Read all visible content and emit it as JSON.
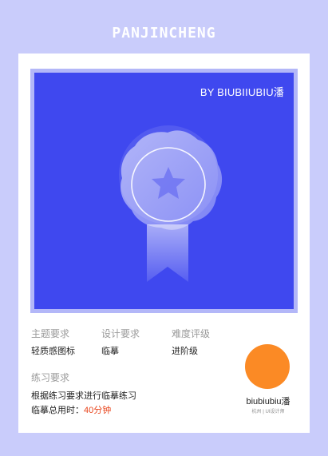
{
  "header": {
    "brand": "PANJINCHENG"
  },
  "hero": {
    "byline": "BY BIUBIIUBIU潘",
    "background_color": "#3f48ef",
    "icon": "medal-star-icon"
  },
  "info": {
    "theme": {
      "label": "主题要求",
      "value": "轻质感图标"
    },
    "design": {
      "label": "设计要求",
      "value": "临摹"
    },
    "difficulty": {
      "label": "难度评级",
      "value": "进阶级"
    },
    "practice": {
      "label": "练习要求",
      "line1": "根据练习要求进行临摹练习",
      "time_label": "临摹总用时：",
      "time_value": "40分钟"
    }
  },
  "author": {
    "name": "biubiubiu潘",
    "subtitle": "杭州 | UI设计师",
    "avatar_color": "#fb8a25"
  }
}
